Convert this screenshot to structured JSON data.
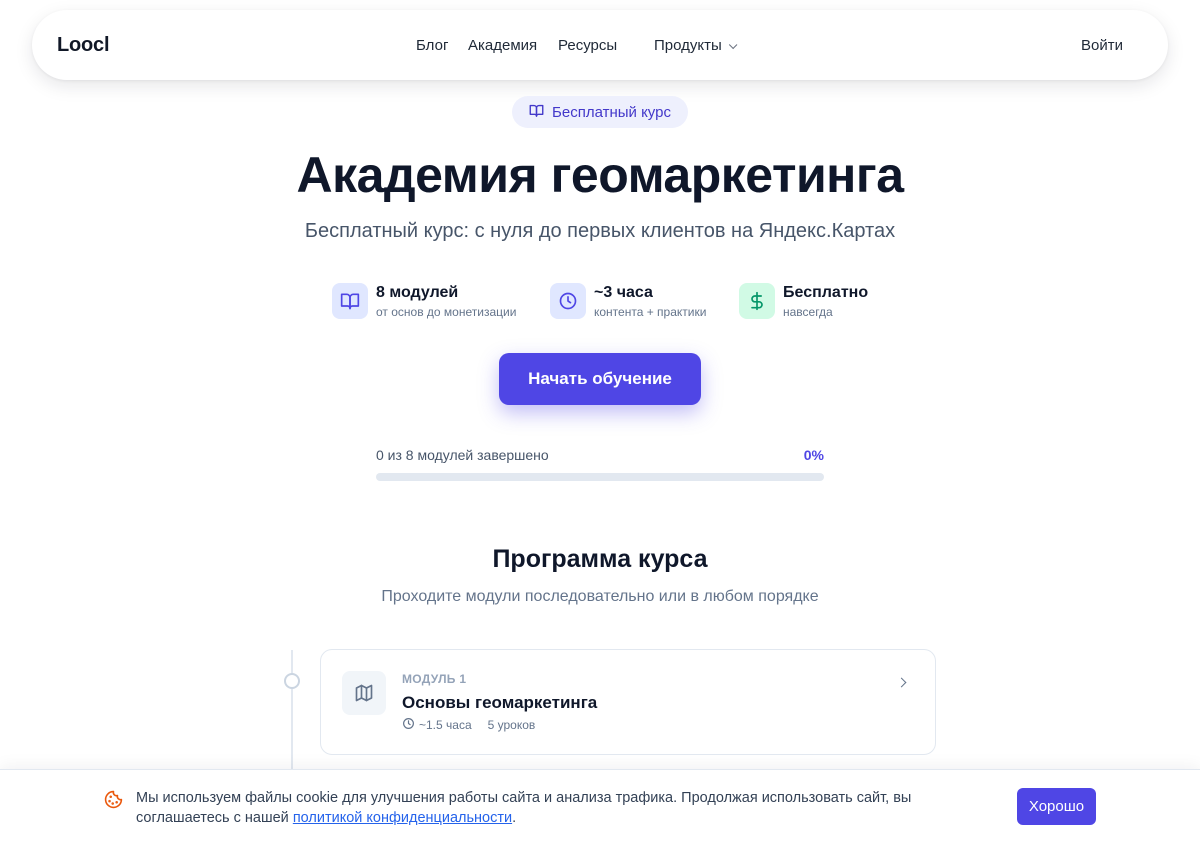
{
  "header": {
    "logo": "Loocl",
    "nav": [
      "Блог",
      "Академия",
      "Ресурсы"
    ],
    "products_label": "Продукты",
    "login_label": "Войти"
  },
  "hero": {
    "badge": "Бесплатный курс",
    "title": "Академия геомаркетинга",
    "subtitle": "Бесплатный курс: с нуля до первых клиентов на Яндекс.Картах",
    "stats": [
      {
        "title": "8 модулей",
        "desc": "от основ до монетизации",
        "icon": "book-icon"
      },
      {
        "title": "~3 часа",
        "desc": "контента + практики",
        "icon": "clock-icon"
      },
      {
        "title": "Бесплатно",
        "desc": "навсегда",
        "icon": "dollar-icon"
      }
    ],
    "cta_label": "Начать обучение"
  },
  "progress": {
    "label": "0 из 8 модулей завершено",
    "percent_label": "0%",
    "fraction": 0
  },
  "program": {
    "title": "Программа курса",
    "subtitle": "Проходите модули последовательно или в любом порядке",
    "modules": [
      {
        "kicker": "МОДУЛЬ 1",
        "title": "Основы геомаркетинга",
        "duration": "~1.5 часа",
        "lessons": "5 уроков",
        "icon": "map-icon"
      }
    ]
  },
  "cookie": {
    "text_before": "Мы используем файлы cookie для улучшения работы сайта и анализа трафика. Продолжая использовать сайт, вы соглашаетесь с нашей ",
    "link_text": "политикой конфиденциальности",
    "text_after": ".",
    "button_label": "Хорошо"
  },
  "colors": {
    "accent": "#4f46e5",
    "badge_bg": "#eef0fd",
    "stat_book_bg": "#e0e7ff",
    "stat_clock_bg": "#e0e7ff",
    "stat_dollar_bg": "#d1fae5",
    "cookie_icon": "#ea580c"
  }
}
